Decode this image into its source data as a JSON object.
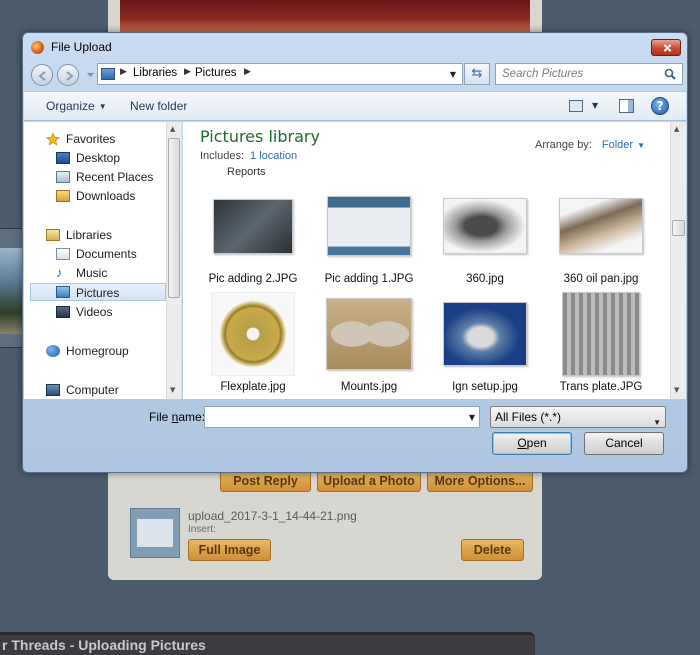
{
  "dialog": {
    "title": "File Upload",
    "breadcrumb": [
      "Libraries",
      "Pictures"
    ],
    "search_placeholder": "Search Pictures",
    "toolbar": {
      "organize": "Organize",
      "new_folder": "New folder"
    },
    "nav": {
      "favorites": "Favorites",
      "desktop": "Desktop",
      "recent_places": "Recent Places",
      "downloads": "Downloads",
      "libraries": "Libraries",
      "documents": "Documents",
      "music": "Music",
      "pictures": "Pictures",
      "videos": "Videos",
      "homegroup": "Homegroup",
      "computer": "Computer"
    },
    "library": {
      "title": "Pictures library",
      "includes_label": "Includes:",
      "location_link": "1 location",
      "arrange_label": "Arrange by:",
      "arrange_value": "Folder",
      "partial_label": "Reports"
    },
    "files": [
      {
        "name": "Pic adding 2.JPG"
      },
      {
        "name": "Pic adding 1.JPG"
      },
      {
        "name": "360.jpg"
      },
      {
        "name": "360 oil pan.jpg"
      },
      {
        "name": "Flexplate.jpg"
      },
      {
        "name": "Mounts.jpg"
      },
      {
        "name": "Ign setup.jpg"
      },
      {
        "name": "Trans plate.JPG"
      }
    ],
    "filename_label_pre": "File ",
    "filename_label_acc": "n",
    "filename_label_post": "ame:",
    "filename_value": "",
    "filetype": "All Files (*.*)",
    "open_acc": "O",
    "open_rest": "pen",
    "cancel": "Cancel"
  },
  "background": {
    "post_reply": "Post Reply",
    "upload_photo": "Upload a Photo",
    "more_options": "More Options...",
    "file_name": "upload_2017-3-1_14-44-21.png",
    "insert": "Insert:",
    "full_image": "Full Image",
    "delete": "Delete",
    "footer": "r Threads - Uploading Pictures"
  }
}
